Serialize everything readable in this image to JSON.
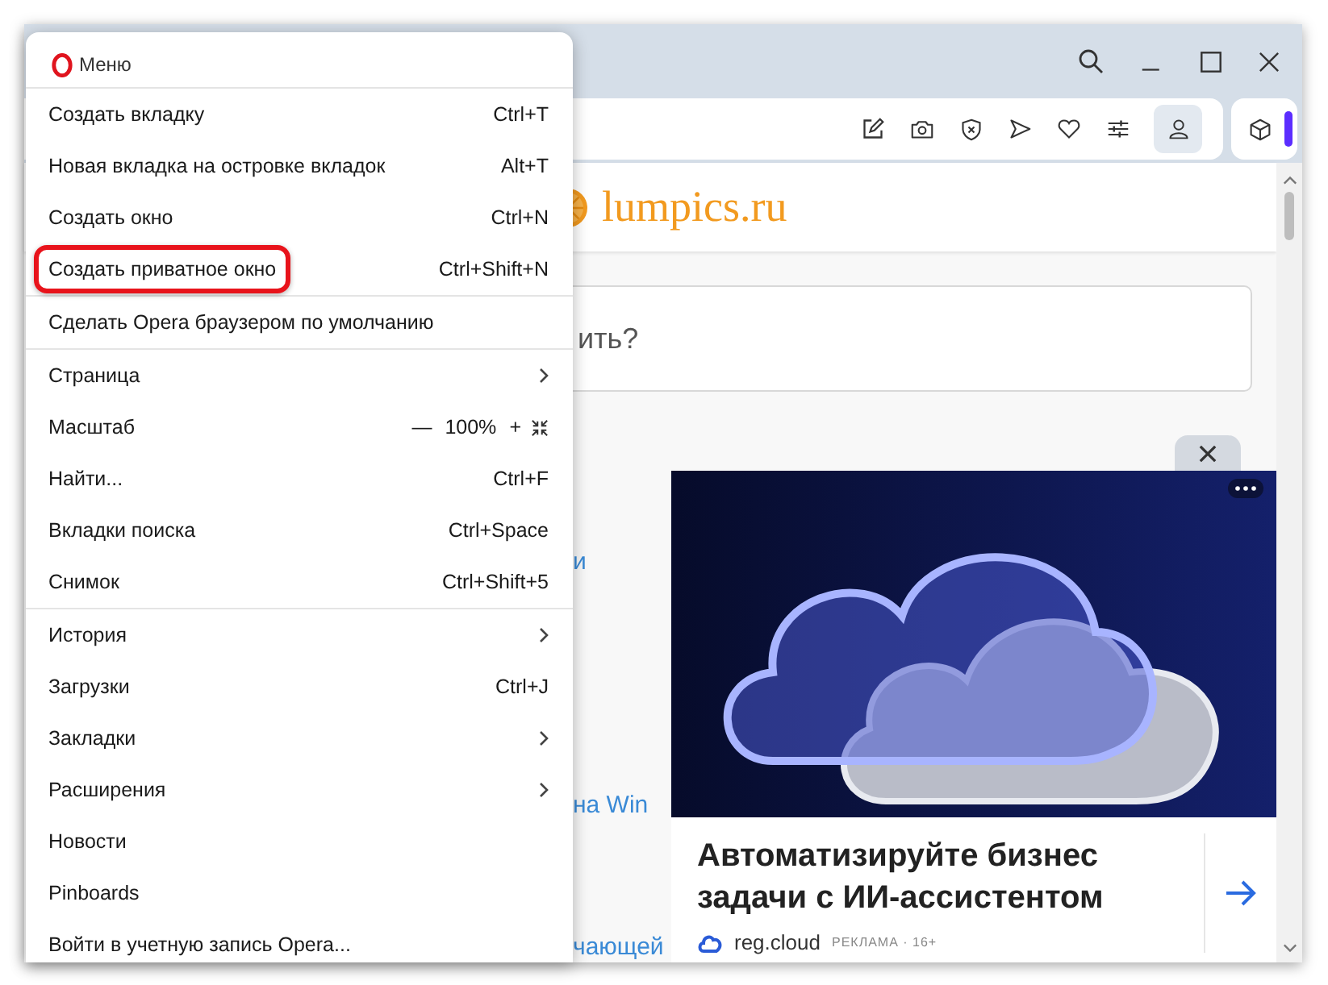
{
  "page": {
    "site_logo": "lumpics.ru",
    "search": {
      "placeholder": "ить?"
    },
    "links": [
      "и",
      "на Win",
      "чающей"
    ],
    "ad": {
      "title": "Автоматизируйте бизнес задачи с ИИ-ассистентом",
      "brand": "reg.cloud",
      "label": "РЕКЛАМА · 16+"
    }
  },
  "menu": {
    "title": "Меню",
    "groups": [
      [
        {
          "kind": "item",
          "label": "Создать вкладку",
          "shortcut": "Ctrl+T",
          "highlighted": false
        },
        {
          "kind": "item",
          "label": "Новая вкладка на островке вкладок",
          "shortcut": "Alt+T",
          "highlighted": false
        },
        {
          "kind": "item",
          "label": "Создать окно",
          "shortcut": "Ctrl+N",
          "highlighted": false
        },
        {
          "kind": "item",
          "label": "Создать приватное окно",
          "shortcut": "Ctrl+Shift+N",
          "highlighted": true
        }
      ],
      [
        {
          "kind": "item",
          "label": "Сделать Opera браузером по умолчанию",
          "highlighted": false
        }
      ],
      [
        {
          "kind": "submenu",
          "label": "Страница",
          "highlighted": false
        },
        {
          "kind": "zoom",
          "label": "Масштаб",
          "minus": "—",
          "value": "100%",
          "plus": "+",
          "highlighted": false
        },
        {
          "kind": "item",
          "label": "Найти...",
          "shortcut": "Ctrl+F",
          "highlighted": false
        },
        {
          "kind": "item",
          "label": "Вкладки поиска",
          "shortcut": "Ctrl+Space",
          "highlighted": false
        },
        {
          "kind": "item",
          "label": "Снимок",
          "shortcut": "Ctrl+Shift+5",
          "highlighted": false
        }
      ],
      [
        {
          "kind": "submenu",
          "label": "История",
          "highlighted": false
        },
        {
          "kind": "item",
          "label": "Загрузки",
          "shortcut": "Ctrl+J",
          "highlighted": false
        },
        {
          "kind": "submenu",
          "label": "Закладки",
          "highlighted": false
        },
        {
          "kind": "submenu",
          "label": "Расширения",
          "highlighted": false
        },
        {
          "kind": "item",
          "label": "Новости",
          "highlighted": false
        },
        {
          "kind": "item",
          "label": "Pinboards",
          "highlighted": false
        },
        {
          "kind": "item",
          "label": "Войти в учетную запись Opera...",
          "highlighted": false
        }
      ]
    ]
  }
}
